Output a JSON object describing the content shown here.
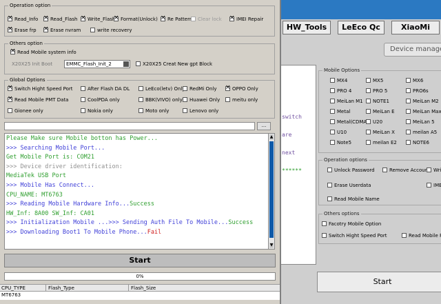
{
  "back": {
    "tabs": [
      "HW_Tools",
      "LeEco Qc",
      "XiaoMi"
    ],
    "device_manager": "Device manager",
    "log_fragments": [
      "switch",
      "are",
      "next",
      "******"
    ],
    "mobile_options": {
      "legend": "Mobile Options",
      "items": [
        "MX4",
        "MX5",
        "MX6",
        "PRO 4",
        "PRO 5",
        "PRO6s",
        "MeiLan M1",
        "NOTE1",
        "MeiLan M2",
        "Metal",
        "MeiLan E",
        "MeiLan Max",
        "Metal(CDMA)",
        "U20",
        "MeiLan 5",
        "U10",
        "MeiLan X",
        "meilan A5",
        "Note5",
        "meilan E2",
        "NOTE6"
      ]
    },
    "operation_options": {
      "legend": "Operation options",
      "items": [
        "Unlock Password",
        "Remove Account",
        "Writ",
        "Erase Userdata",
        "IME",
        "Read Mobile Name"
      ]
    },
    "others_options": {
      "legend": "Others options",
      "items": [
        "Facotry Mobile Option",
        "Switch Hight Speed Port",
        "Read Mobile P"
      ]
    },
    "start_label": "Start"
  },
  "operation": {
    "legend": "Operation option",
    "items": [
      "Read_Info",
      "Read_Flash",
      "Write_Flash",
      "Format(Unlock)",
      "Re Pattern",
      "Clear lock",
      "IMEI Repair",
      "Erase frp",
      "Erase nvram",
      "write recovery"
    ]
  },
  "others": {
    "legend": "Others option",
    "read_mobile_system_info": "Read Mobile system info",
    "init_boot_label": "X20X25 Init Boot",
    "init_boot_value": "EMMC_Flash_Init_2",
    "creat_gpt": "X20X25 Creat New gpt Block"
  },
  "global": {
    "legend": "Global Options",
    "items": [
      "Switch Hight Speed Port",
      "After Flash DA DL",
      "LeEco(letv) Only",
      "RedMi Only",
      "OPPO Only",
      "Read Mobile PMT Data",
      "CoolPDA only",
      "BBK(VIVO) only",
      "Huawei Only",
      "meitu only",
      "Gionee only",
      "Nokia only",
      "Moto only",
      "Lenovo only"
    ]
  },
  "browse_label": "...",
  "log": [
    {
      "text": "     Please Make sure Mobile botton has Power...",
      "color": "#2e9e2e"
    },
    {
      "text": ">>> Searching Mobile Port...",
      "color": "#4040d8"
    },
    {
      "text": "    Get Mobile Port is:  COM21",
      "color": "#2e9e2e"
    },
    {
      "text": ">>> Device driver identification:",
      "color": "#909090"
    },
    {
      "text": "    MediaTek USB Port",
      "color": "#2e9e2e"
    },
    {
      "text": ">>> Mobile Has Connect...",
      "color": "#4040d8"
    },
    {
      "text": "    CPU_NAME: MT6763",
      "color": "#2e9e2e"
    },
    {
      "text": ">>> Reading Mobile Hardware Info...Success",
      "color": "#4040d8",
      "success": "Success"
    },
    {
      "text": "    HW_Inf: 8A00   SW_Inf: CA01",
      "color": "#2e9e2e"
    },
    {
      "text": ">>> Initialization Mobile ...>>> Sending Auth File To Mobile...Success",
      "color": "#4040d8"
    },
    {
      "text": ">>> Downloading Boot1 To Mobile Phone...Fail",
      "color": "#4040d8"
    }
  ],
  "start_label": "Start",
  "progress": {
    "text": "0%",
    "value": 0
  },
  "table": {
    "headers": [
      "CPU_TYPE",
      "Flash_Type",
      "Flash_Size"
    ],
    "rows": [
      [
        "MT6763",
        "",
        ""
      ]
    ]
  },
  "colors": {
    "accent": "#0f5aa8",
    "log_green": "#2e9e2e",
    "log_blue": "#4040d8",
    "log_red": "#d02020",
    "back_title": "#2b79c2"
  }
}
